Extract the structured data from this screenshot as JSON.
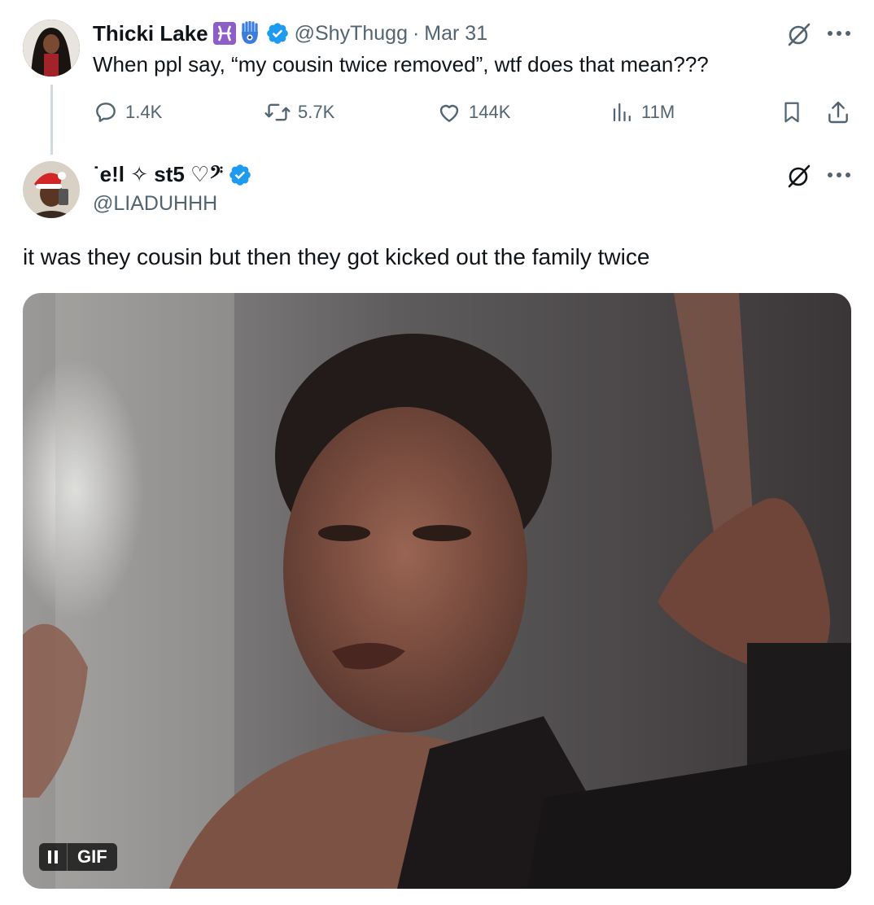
{
  "tweet1": {
    "author_name": "Thicki Lake",
    "author_emojis": "♓🪬",
    "handle": "@ShyThugg",
    "separator": "·",
    "date": "Mar 31",
    "text": "When ppl say, “my cousin twice removed”, wtf does that mean???",
    "stats": {
      "replies": "1.4K",
      "retweets": "5.7K",
      "likes": "144K",
      "views": "11M"
    }
  },
  "tweet2": {
    "author_name": "˙e!l ✧ st5 ♡𝄢",
    "handle": "@LIADUHHH",
    "text": "it was they cousin but then they got kicked out the family twice",
    "media": {
      "type": "gif",
      "badge_label": "GIF"
    }
  },
  "colors": {
    "verified_blue": "#1d9bf0",
    "muted": "#536471",
    "text": "#0f1419",
    "thread_line": "#cfd9de"
  }
}
